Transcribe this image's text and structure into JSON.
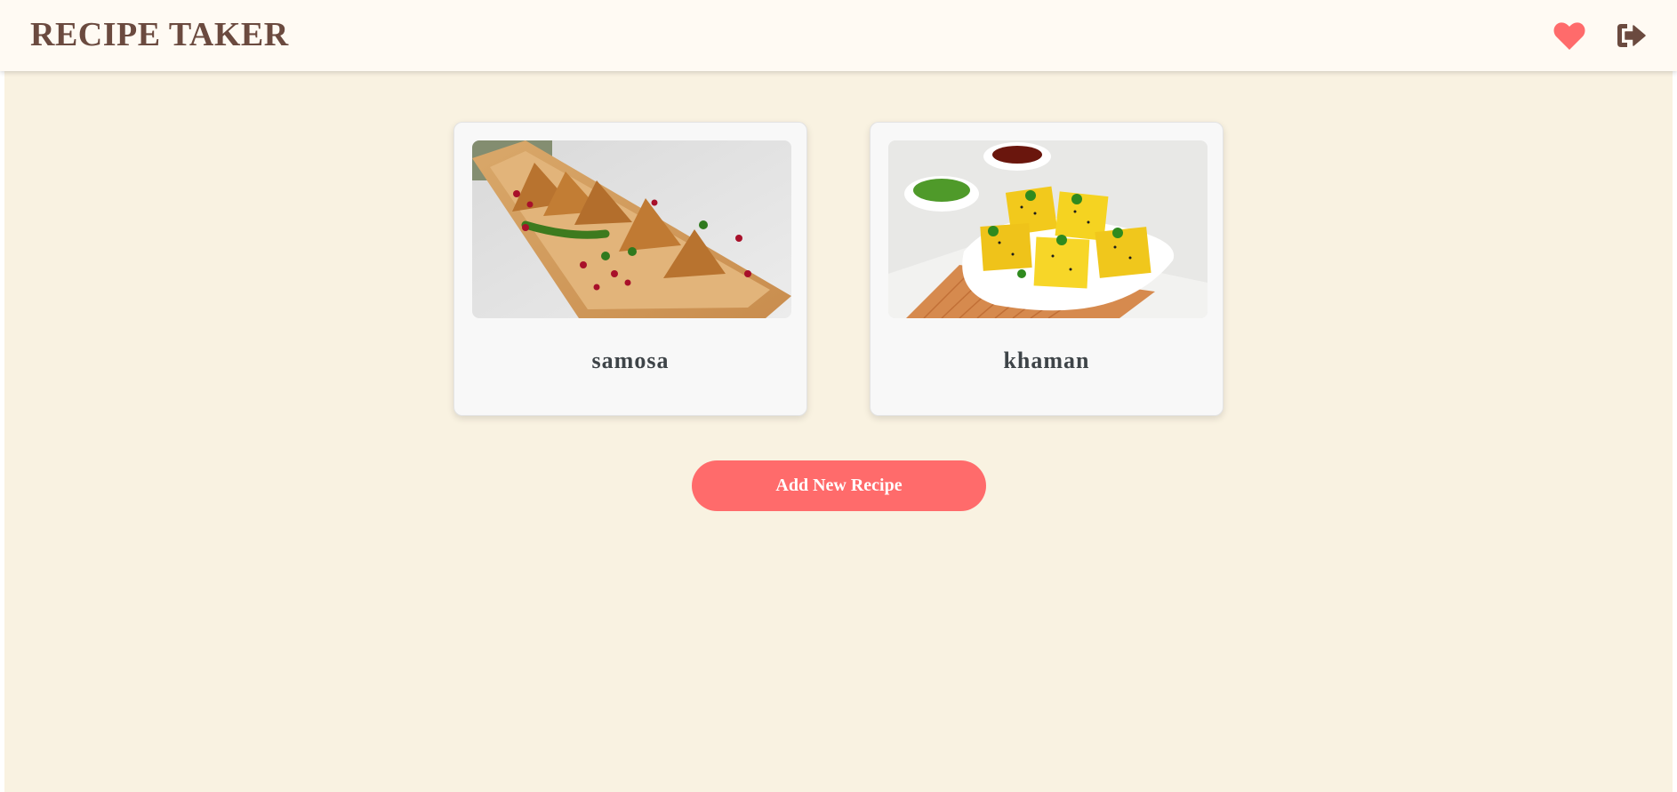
{
  "app": {
    "title": "RECIPE TAKER"
  },
  "nav": {
    "favorites_icon": "heart-icon",
    "logout_icon": "sign-out-icon",
    "heart_color": "#ff6b6b",
    "icon_color": "#6b4a3f"
  },
  "recipes": [
    {
      "name": "samosa",
      "image": "samosa-photo"
    },
    {
      "name": "khaman",
      "image": "khaman-photo"
    }
  ],
  "actions": {
    "add_label": "Add New Recipe"
  },
  "colors": {
    "background": "#f9f2e1",
    "navbar": "#fffaf3",
    "accent": "#ff6b6b",
    "brand_text": "#6b4a3f"
  }
}
